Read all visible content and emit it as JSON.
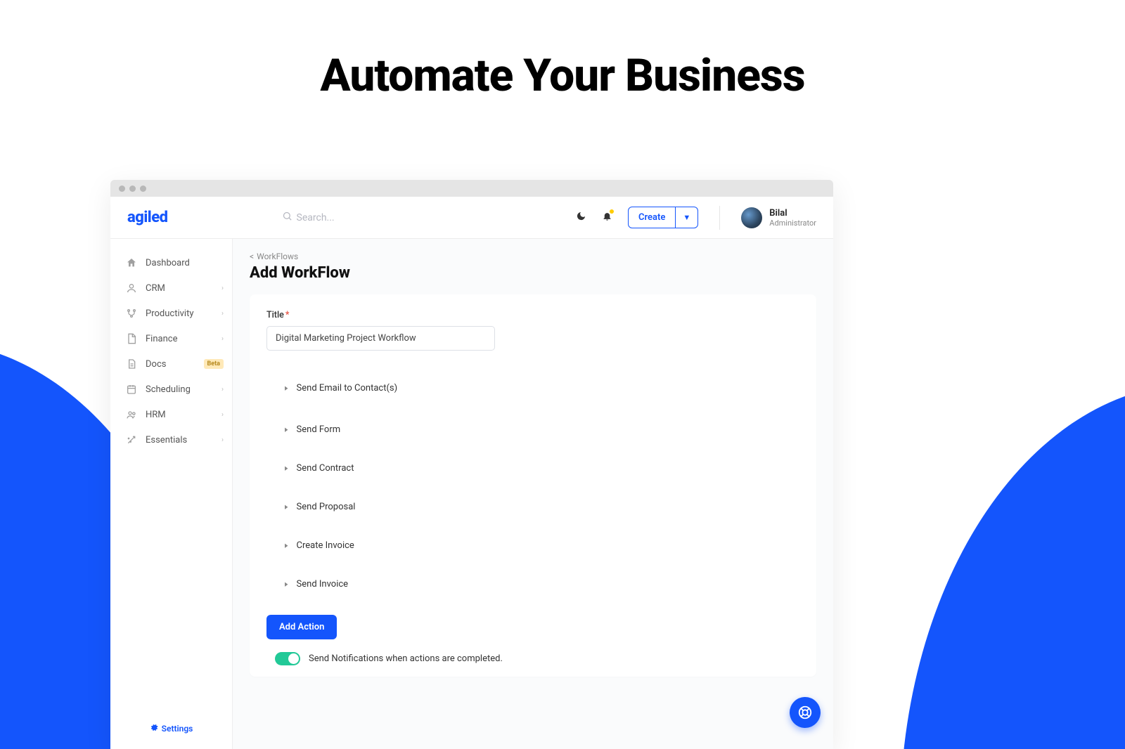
{
  "hero_title": "Automate Your Business",
  "brand": "agiled",
  "search": {
    "placeholder": "Search..."
  },
  "create_label": "Create",
  "user": {
    "name": "Bilal",
    "role": "Administrator"
  },
  "sidebar": {
    "items": [
      {
        "label": "Dashboard",
        "icon": "home",
        "expandable": false
      },
      {
        "label": "CRM",
        "icon": "user",
        "expandable": true
      },
      {
        "label": "Productivity",
        "icon": "branch",
        "expandable": true
      },
      {
        "label": "Finance",
        "icon": "doc",
        "expandable": true
      },
      {
        "label": "Docs",
        "icon": "file",
        "expandable": false,
        "badge": "Beta"
      },
      {
        "label": "Scheduling",
        "icon": "calendar",
        "expandable": true
      },
      {
        "label": "HRM",
        "icon": "people",
        "expandable": true
      },
      {
        "label": "Essentials",
        "icon": "wand",
        "expandable": true
      }
    ],
    "settings_label": "Settings"
  },
  "breadcrumb": {
    "back_icon": "<",
    "label": "WorkFlows"
  },
  "page_title": "Add WorkFlow",
  "form": {
    "title_label": "Title",
    "title_required": "*",
    "title_value": "Digital Marketing Project Workflow",
    "actions": [
      "Send Email to Contact(s)",
      "Send Form",
      "Send Contract",
      "Send Proposal",
      "Create Invoice",
      "Send Invoice"
    ],
    "add_action_label": "Add Action",
    "notify_label": "Send Notifications when actions are completed."
  }
}
